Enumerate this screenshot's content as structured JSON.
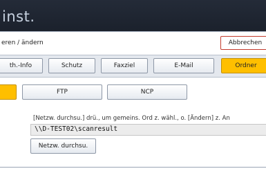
{
  "header": {
    "title": "inst."
  },
  "action_bar": {
    "breadcrumb": "eren / ändern",
    "cancel_label": "Abbrechen"
  },
  "tabs": [
    {
      "label": "th.-Info",
      "selected": false
    },
    {
      "label": "Schutz",
      "selected": false
    },
    {
      "label": "Faxziel",
      "selected": false
    },
    {
      "label": "E-Mail",
      "selected": false
    },
    {
      "label": "Ordner",
      "selected": true
    }
  ],
  "protocols": [
    {
      "label": "",
      "selected": true
    },
    {
      "label": "FTP",
      "selected": false
    },
    {
      "label": "NCP",
      "selected": false
    }
  ],
  "folder": {
    "hint": "[Netzw. durchsu.] drü., um gemeins. Ord z. wähl., o. [Ändern] z. An",
    "path": "\\\\D-TEST02\\scanresult",
    "browse_label": "Netzw. durchsu."
  },
  "colors": {
    "selected": "#ffbf00",
    "cancel_border": "#c23a2c",
    "titlebar": "#1e2430"
  }
}
